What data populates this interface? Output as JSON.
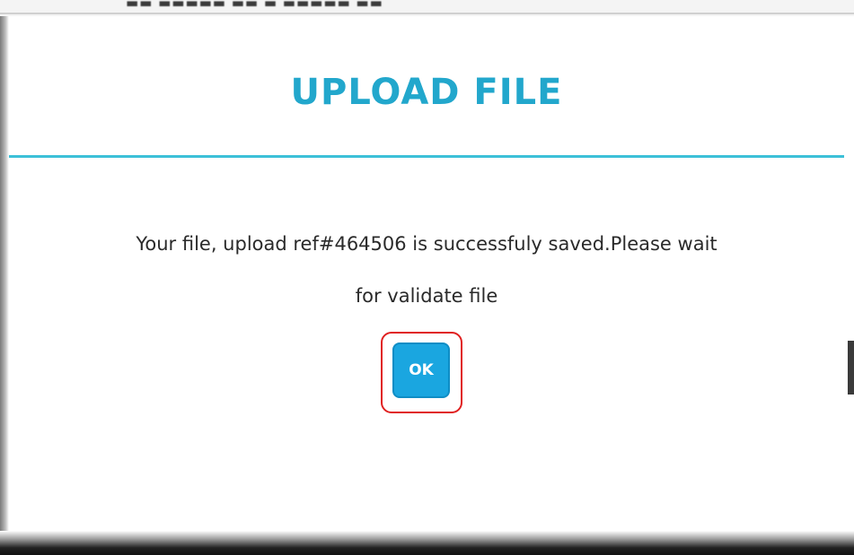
{
  "dialog": {
    "title": "UPLOAD FILE",
    "message_line1": "Your file, upload ref#464506 is successfuly saved.Please wait",
    "message_line2": "for validate file",
    "ok_label": "OK"
  },
  "background": {
    "top_strip_text": "▬▬  ▬▬▬▬▬  ▬▬ ▬  ▬▬▬▬▬  ▬▬"
  },
  "colors": {
    "title": "#22a7cc",
    "divider": "#3cc0d8",
    "ok_button": "#1aa6e0",
    "highlight": "#e02020"
  }
}
